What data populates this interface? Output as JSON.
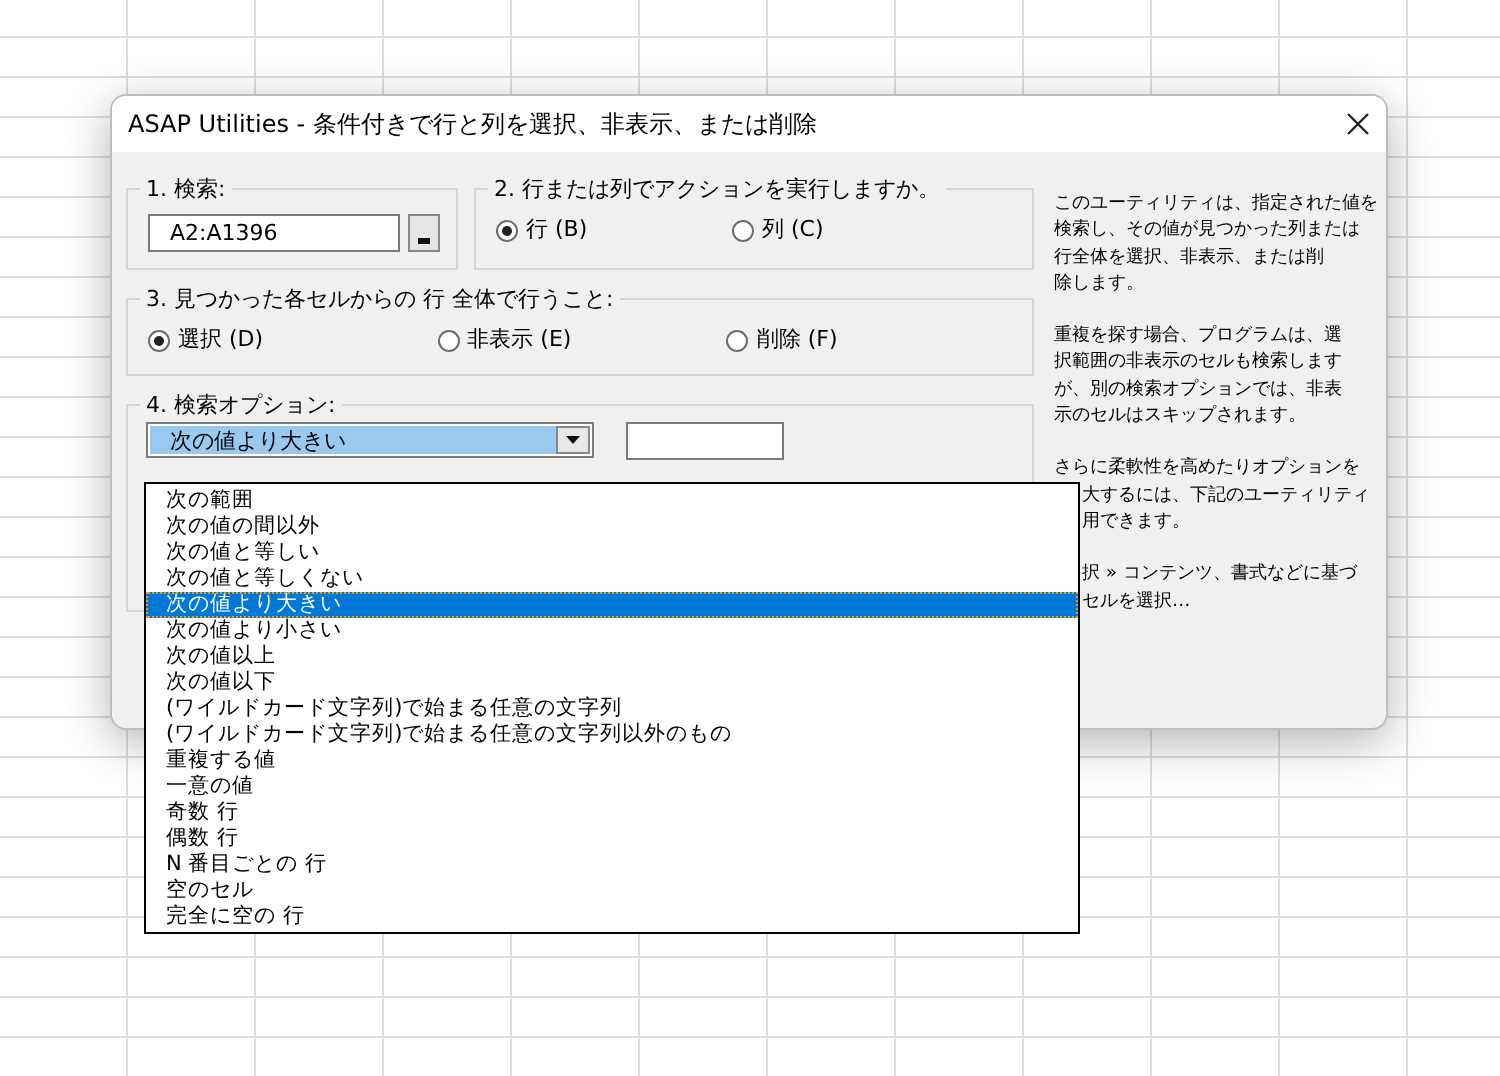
{
  "window": {
    "title": "ASAP Utilities - 条件付きで行と列を選択、非表示、または削除"
  },
  "search": {
    "legend": "1. 検索:",
    "value": "A2:A1396"
  },
  "apply_to": {
    "legend": "2. 行または列でアクションを実行しますか。",
    "options": [
      {
        "label": "行 (B)",
        "selected": true
      },
      {
        "label": "列 (C)",
        "selected": false
      }
    ]
  },
  "action": {
    "legend": "3. 見つかった各セルからの 行 全体で行うこと:",
    "options": [
      {
        "label": "選択 (D)",
        "selected": true
      },
      {
        "label": "非表示 (E)",
        "selected": false
      },
      {
        "label": "削除 (F)",
        "selected": false
      }
    ]
  },
  "search_options": {
    "legend": "4. 検索オプション:",
    "combo_value": "次の値より大きい",
    "dropdown_items": [
      {
        "label": "次の範囲",
        "selected": false
      },
      {
        "label": "次の値の間以外",
        "selected": false
      },
      {
        "label": "次の値と等しい",
        "selected": false
      },
      {
        "label": "次の値と等しくない",
        "selected": false
      },
      {
        "label": "次の値より大きい",
        "selected": true
      },
      {
        "label": "次の値より小さい",
        "selected": false
      },
      {
        "label": "次の値以上",
        "selected": false
      },
      {
        "label": "次の値以下",
        "selected": false
      },
      {
        "label": "(ワイルドカード文字列)で始まる任意の文字列",
        "selected": false
      },
      {
        "label": "(ワイルドカード文字列)で始まる任意の文字列以外のもの",
        "selected": false
      },
      {
        "label": "重複する値",
        "selected": false
      },
      {
        "label": "一意の値",
        "selected": false
      },
      {
        "label": "奇数 行",
        "selected": false
      },
      {
        "label": "偶数 行",
        "selected": false
      },
      {
        "label": "N 番目ごとの 行",
        "selected": false
      },
      {
        "label": "空のセル",
        "selected": false
      },
      {
        "label": "完全に空の 行",
        "selected": false
      }
    ]
  },
  "description": {
    "paragraphs": [
      {
        "lines": [
          {
            "text": "このユーティリティは、指定された値を"
          },
          {
            "text": "検索し、その値が見つかった列または"
          },
          {
            "text": "行全体を選択、非表示、または削"
          },
          {
            "text": "除します。"
          }
        ]
      },
      {
        "lines": [
          {
            "text": "重複を探す場合、プログラムは、選"
          },
          {
            "text": "択範囲の非表示のセルも検索します"
          },
          {
            "text": "が、別の検索オプションでは、非表"
          },
          {
            "text": "示のセルはスキップされます。"
          }
        ]
      },
      {
        "lines": [
          {
            "text": "さらに柔軟性を高めたりオプションを"
          },
          {
            "text": "大するには、下記のユーティリティ",
            "covered": true
          },
          {
            "text": "用できます。",
            "covered": true
          }
        ]
      },
      {
        "lines": [
          {
            "text": "択 » コンテンツ、書式などに基づ",
            "covered": true
          },
          {
            "text": "セルを選択…",
            "covered": true
          }
        ]
      }
    ]
  }
}
